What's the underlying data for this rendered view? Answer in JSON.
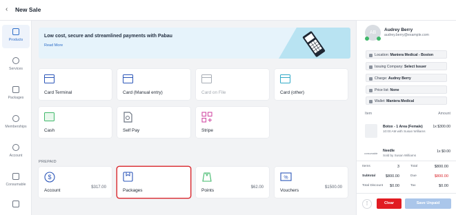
{
  "header": {
    "back_glyph": "‹",
    "title": "New Sale"
  },
  "sidebar": {
    "items": [
      {
        "label": "Products",
        "icon": "products-icon",
        "active": true
      },
      {
        "label": "Services",
        "icon": "services-icon"
      },
      {
        "label": "Packages",
        "icon": "packages-icon"
      },
      {
        "label": "Memberships",
        "icon": "memberships-icon"
      },
      {
        "label": "Account",
        "icon": "account-icon"
      },
      {
        "label": "Consumable",
        "icon": "consumable-icon"
      }
    ]
  },
  "banner": {
    "headline": "Low cost, secure and streamlined payments with Pabau",
    "link": "Read More"
  },
  "payment_methods": [
    {
      "label": "Card Terminal",
      "icon": "card-icon",
      "enabled": true
    },
    {
      "label": "Card (Manual entry)",
      "icon": "card-icon",
      "enabled": true
    },
    {
      "label": "Card on File",
      "icon": "card-icon",
      "enabled": false
    },
    {
      "label": "Card (other)",
      "icon": "card-icon",
      "enabled": true
    },
    {
      "label": "Cash",
      "icon": "cash-icon",
      "enabled": true
    },
    {
      "label": "Self Pay",
      "icon": "self-pay-icon",
      "enabled": true
    },
    {
      "label": "Stripe",
      "icon": "stripe-icon",
      "enabled": true
    }
  ],
  "prepaid": {
    "heading": "PREPAID",
    "items": [
      {
        "label": "Account",
        "amount": "$317.00",
        "icon": "dollar-icon"
      },
      {
        "label": "Packages",
        "amount": "",
        "icon": "package-icon",
        "selected": true
      },
      {
        "label": "Points",
        "amount": "$62.00",
        "icon": "points-icon"
      },
      {
        "label": "Vouchers",
        "amount": "$1500.00",
        "icon": "voucher-icon"
      }
    ]
  },
  "client": {
    "initials": "AB",
    "name": "Audrey Berry",
    "email": "audrey.berry@example.com",
    "details": [
      {
        "key": "Location: ",
        "value": "Maniera Medical - Boston"
      },
      {
        "key": "Issuing Company: ",
        "value": "Select Issuer"
      },
      {
        "key": "Charge: ",
        "value": "Audrey Berry"
      },
      {
        "key": "Price list: ",
        "value": "None"
      },
      {
        "key": "Wallet: ",
        "value": "Maniera Medical"
      }
    ]
  },
  "cart": {
    "col_item": "Item",
    "col_amount": "Amount",
    "items": [
      {
        "name": "Botox - 1 Area (Female)",
        "sub": "10:00 AM with Susan Williams",
        "amount": "1x $300.00",
        "thumb": ""
      },
      {
        "name": "Needle",
        "sub": "Sold by Susan Williams",
        "amount": "1x $0.00",
        "thumb": "consumable"
      }
    ]
  },
  "totals": {
    "items_label": "Items",
    "items_value": "3",
    "total_label": "Total",
    "total_value": "$800.00",
    "subtotal_label": "Subtotal",
    "subtotal_value": "$800.00",
    "due_label": "Due",
    "due_value": "$800.00",
    "discount_label": "Total Discount",
    "discount_value": "$0.00",
    "tax_label": "Tax",
    "tax_value": "$0.00"
  },
  "actions": {
    "more": "⋮",
    "clear": "Clear",
    "save": "Save Unpaid"
  },
  "colors": {
    "accent": "#2e6ec8",
    "danger": "#e11b22",
    "save_disabled": "#aac6ea"
  }
}
